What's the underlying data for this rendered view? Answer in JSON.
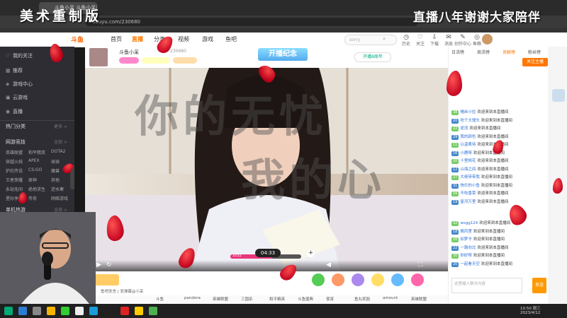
{
  "overlay": {
    "left_title": "美术重制版",
    "right_title": "直播八年谢谢大家陪伴"
  },
  "browser": {
    "tab1_label": "斗鱼小呆 斗鱼小呆直播间",
    "url": "douyu.com/230680"
  },
  "site_header": {
    "logo_text": "斗鱼",
    "nav": [
      "首页",
      "直播",
      "分类",
      "视频",
      "游戏",
      "鱼吧"
    ],
    "active_nav": "直播",
    "search_placeholder": "sorry",
    "icons": [
      {
        "label": "历史",
        "icon": "clock-icon"
      },
      {
        "label": "关注",
        "icon": "heart-icon"
      },
      {
        "label": "下载",
        "icon": "download-icon"
      },
      {
        "label": "消息",
        "icon": "message-icon"
      },
      {
        "label": "创作中心",
        "icon": "create-icon"
      },
      {
        "label": "鱼粮",
        "icon": "coin-icon"
      }
    ]
  },
  "sidebar": {
    "items": [
      {
        "icon": "heart-icon",
        "label": "我的关注"
      },
      {
        "icon": "grid-icon",
        "label": "推荐"
      },
      {
        "icon": "game-icon",
        "label": "游戏中心"
      },
      {
        "icon": "gift-icon",
        "label": "云游戏"
      },
      {
        "icon": "fire-icon",
        "label": "直播"
      }
    ],
    "hot_section": "热门分类",
    "hot_more": "更多 >",
    "section2": "网游竞技",
    "section2_more": "全部 >",
    "categories": [
      [
        "英雄联盟",
        "和平精英",
        "DOTA2"
      ],
      [
        "穿越火线",
        "APEX",
        "球球"
      ],
      [
        "炉石传说",
        "CS:GO",
        "魔兽"
      ],
      [
        "王者荣耀",
        "原神",
        "其他"
      ],
      [
        "永劫无间",
        "绝地求生",
        "逆水寒"
      ],
      [
        "星际争霸",
        "传奇",
        "网络游戏"
      ]
    ],
    "section3": "单机热游",
    "section3_more": "全部 >"
  },
  "infobar": {
    "streamer_name": "斗鱼小呆",
    "room_no": "230680",
    "anniversary_badge": "开播纪念",
    "anniversary_label": "开播8周年"
  },
  "video": {
    "overlay_text1": "你的无忧",
    "overlay_text2": "我的心",
    "timer": "04:33",
    "progress_label": "1032",
    "progress": 0.6
  },
  "giftbar": {
    "danmu_placeholder": "鱼吧发言 | 发弹幕@小呆"
  },
  "tagbar": {
    "tags": [
      "斗鱼",
      "pandora",
      "英雄联盟",
      "三国杀",
      "和平精英",
      "斗鱼盛典",
      "夜宵",
      "鱼丸奖励",
      "amount",
      "英雄联盟"
    ]
  },
  "right_panel": {
    "tabs": [
      "日活榜",
      "周活榜",
      "贡献榜",
      "粉丝榜"
    ],
    "active_tab": "贡献榜",
    "follow_button": "关注主播",
    "chat": [
      {
        "level": "38",
        "name": "喵丝小拉",
        "text": "欢迎来到本直播间"
      },
      {
        "level": "20",
        "name": "吃个大馒头",
        "text": "欢迎来到本直播间"
      },
      {
        "level": "22",
        "name": "逆流",
        "text": "欢迎来到本直播间"
      },
      {
        "level": "29",
        "name": "我的颜色",
        "text": "欢迎来到本直播间"
      },
      {
        "level": "11",
        "name": "以温柔待",
        "text": "欢迎来到本直播间"
      },
      {
        "level": "16",
        "name": "小鹿呀",
        "text": "欢迎来到本直播间"
      },
      {
        "level": "20",
        "name": "十里桃花",
        "text": "欢迎来到本直播间"
      },
      {
        "level": "12",
        "name": "山海之间",
        "text": "欢迎来到本直播间"
      },
      {
        "level": "27",
        "name": "大佬带带我",
        "text": "欢迎来到本直播间"
      },
      {
        "level": "31",
        "name": "快乐的小鱼",
        "text": "欢迎来到本直播间"
      },
      {
        "level": "16",
        "name": "不吃香菜",
        "text": "欢迎来到本直播间"
      },
      {
        "level": "19",
        "name": "星河万里",
        "text": "欢迎来到本直播间"
      }
    ],
    "chat2": [
      {
        "level": "22",
        "name": "wsgg124",
        "text": "欢迎来到本直播间"
      },
      {
        "level": "18",
        "name": "晚风里",
        "text": "欢迎来到本直播间"
      },
      {
        "level": "26",
        "name": "如梦令",
        "text": "欢迎来到本直播间"
      },
      {
        "level": "22",
        "name": "一路向北",
        "text": "欢迎来到本直播间"
      },
      {
        "level": "30",
        "name": "你好呀",
        "text": "欢迎来到本直播间"
      },
      {
        "level": "20",
        "name": "一起看天空",
        "text": "欢迎来到本直播间"
      }
    ],
    "input_placeholder": "这里输入聊天内容",
    "send_button": "发送"
  },
  "taskbar": {
    "time": "10:50 周三",
    "date": "2023/4/12"
  }
}
